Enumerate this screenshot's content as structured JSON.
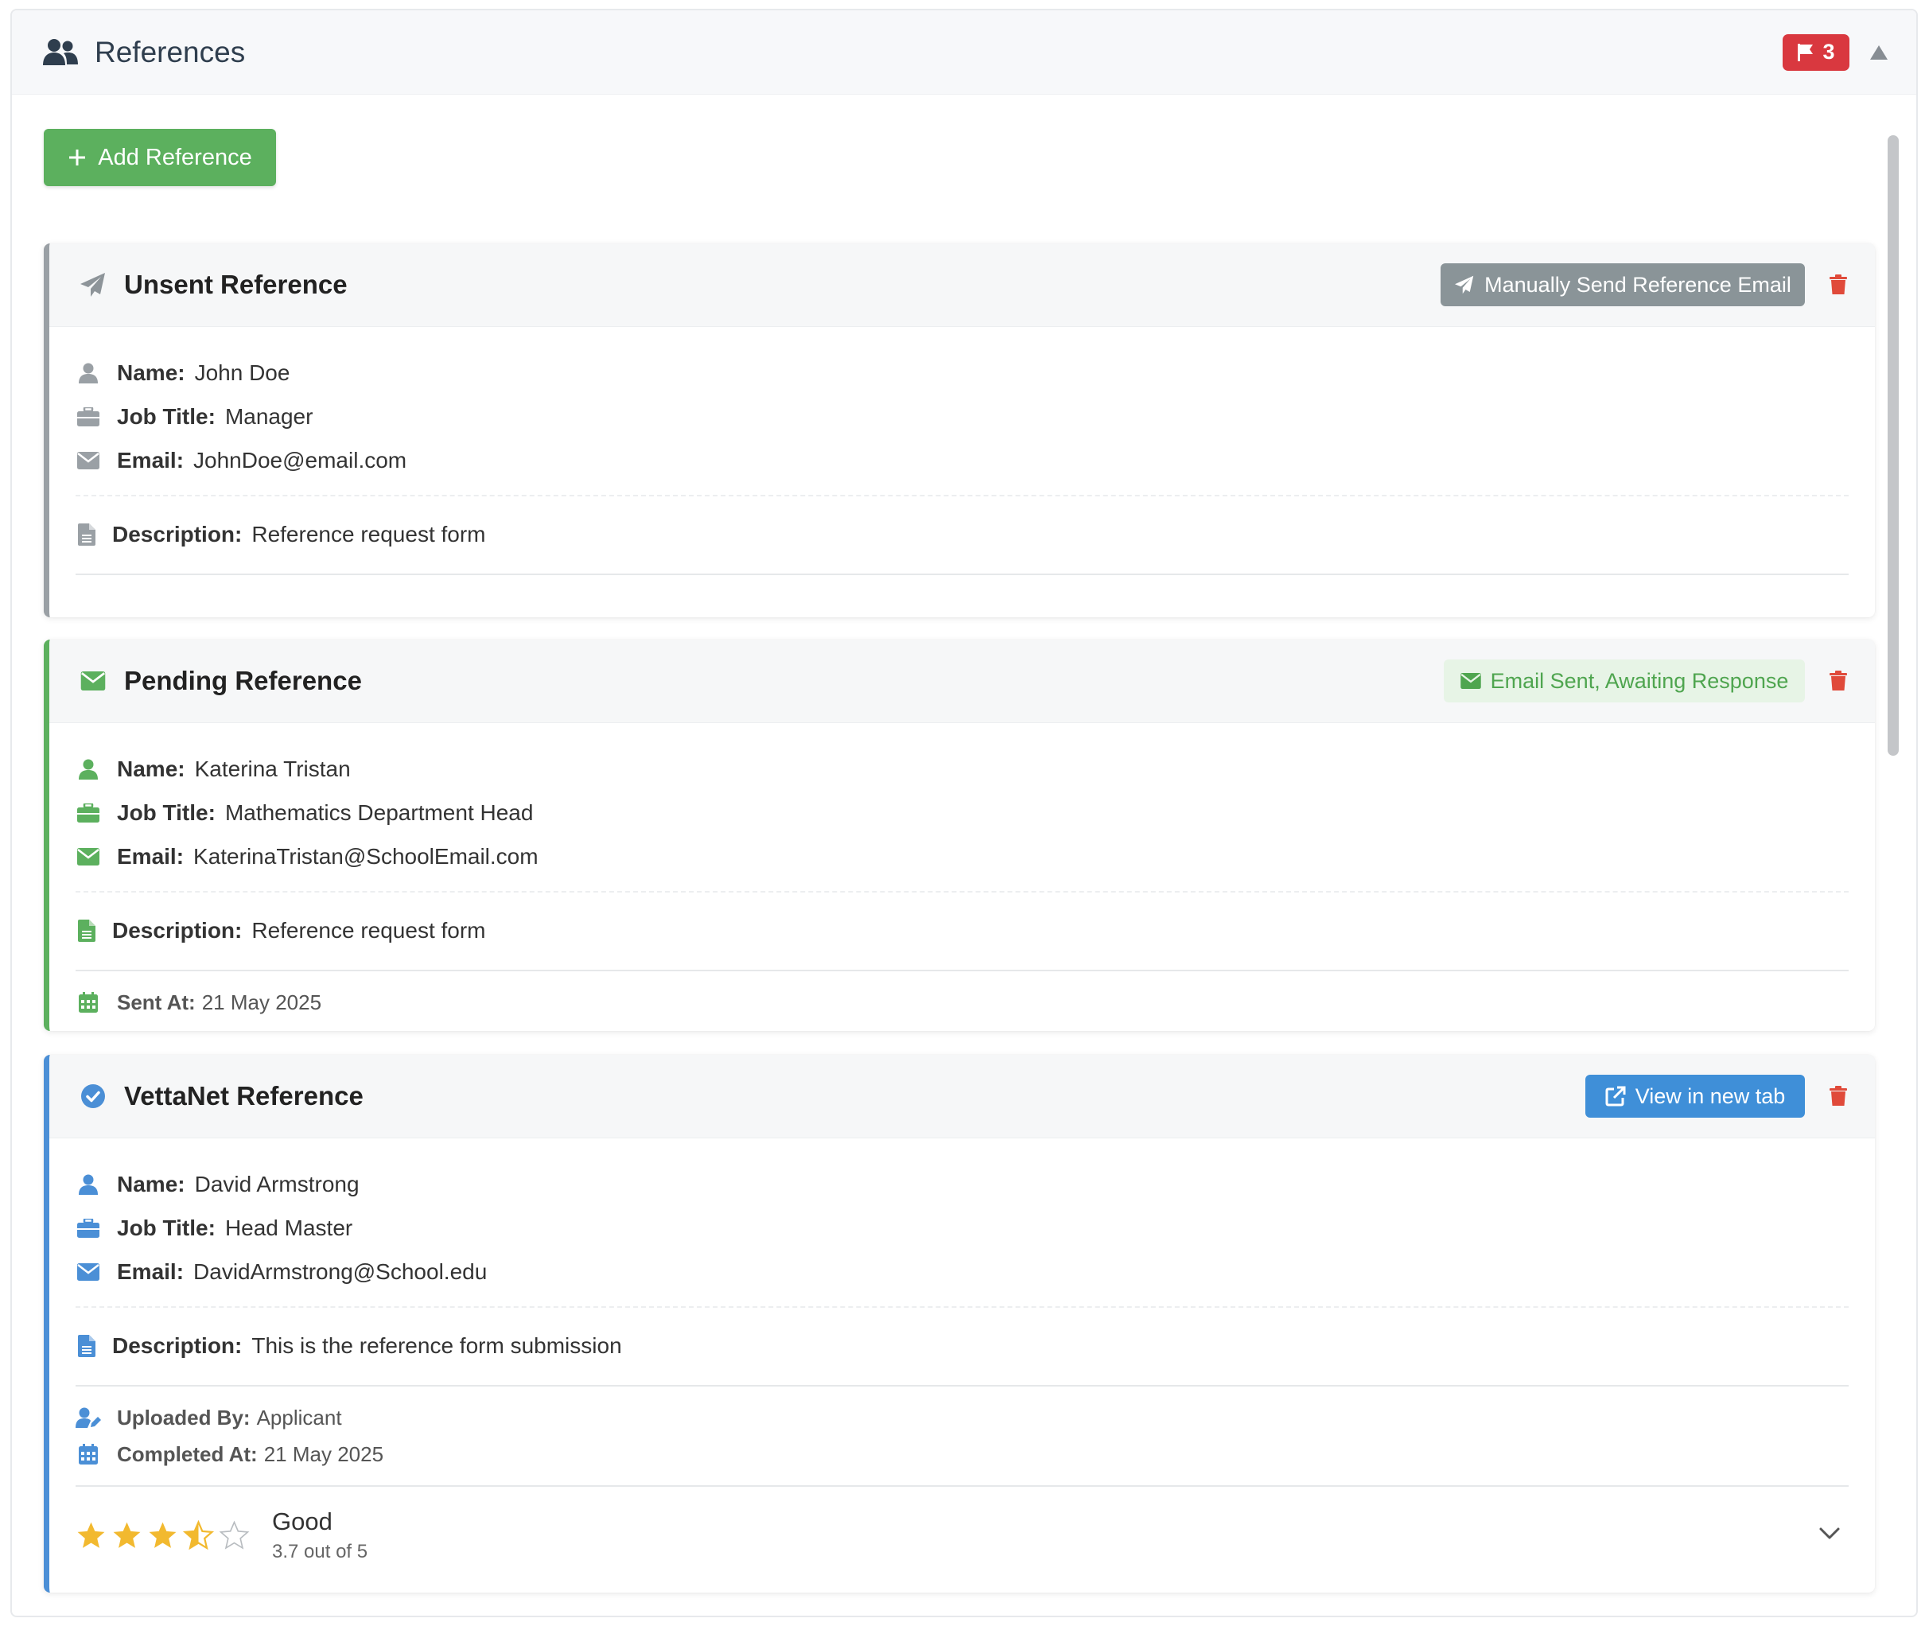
{
  "header": {
    "title": "References",
    "flag_count": "3"
  },
  "add_button": {
    "label": "Add Reference"
  },
  "cards": [
    {
      "title": "Unsent Reference",
      "action_label": "Manually Send Reference Email",
      "name_label": "Name:",
      "name": "John Doe",
      "job_label": "Job Title:",
      "job": "Manager",
      "email_label": "Email:",
      "email": "JohnDoe@email.com",
      "desc_label": "Description:",
      "desc": "Reference request form",
      "accent": "#9aa0a5"
    },
    {
      "title": "Pending Reference",
      "action_label": "Email Sent, Awaiting Response",
      "name_label": "Name:",
      "name": "Katerina Tristan",
      "job_label": "Job Title:",
      "job": "Mathematics Department Head",
      "email_label": "Email:",
      "email": "KaterinaTristan@SchoolEmail.com",
      "desc_label": "Description:",
      "desc": "Reference request form",
      "sent_label": "Sent At:",
      "sent": "21 May 2025",
      "accent": "#5cb05e"
    },
    {
      "title": "VettaNet Reference",
      "action_label": "View in new tab",
      "name_label": "Name:",
      "name": "David Armstrong",
      "job_label": "Job Title:",
      "job": "Head Master",
      "email_label": "Email:",
      "email": "DavidArmstrong@School.edu",
      "desc_label": "Description:",
      "desc": "This is the reference form submission",
      "uploaded_label": "Uploaded By:",
      "uploaded": "Applicant",
      "completed_label": "Completed At:",
      "completed": "21 May 2025",
      "rating_word": "Good",
      "rating_text": "3.7 out of 5",
      "rating_value": 3.7,
      "rating_max": 5,
      "accent": "#4b8fd6"
    }
  ],
  "colors": {
    "danger": "#e04a3a",
    "star": "#f2b92f"
  }
}
